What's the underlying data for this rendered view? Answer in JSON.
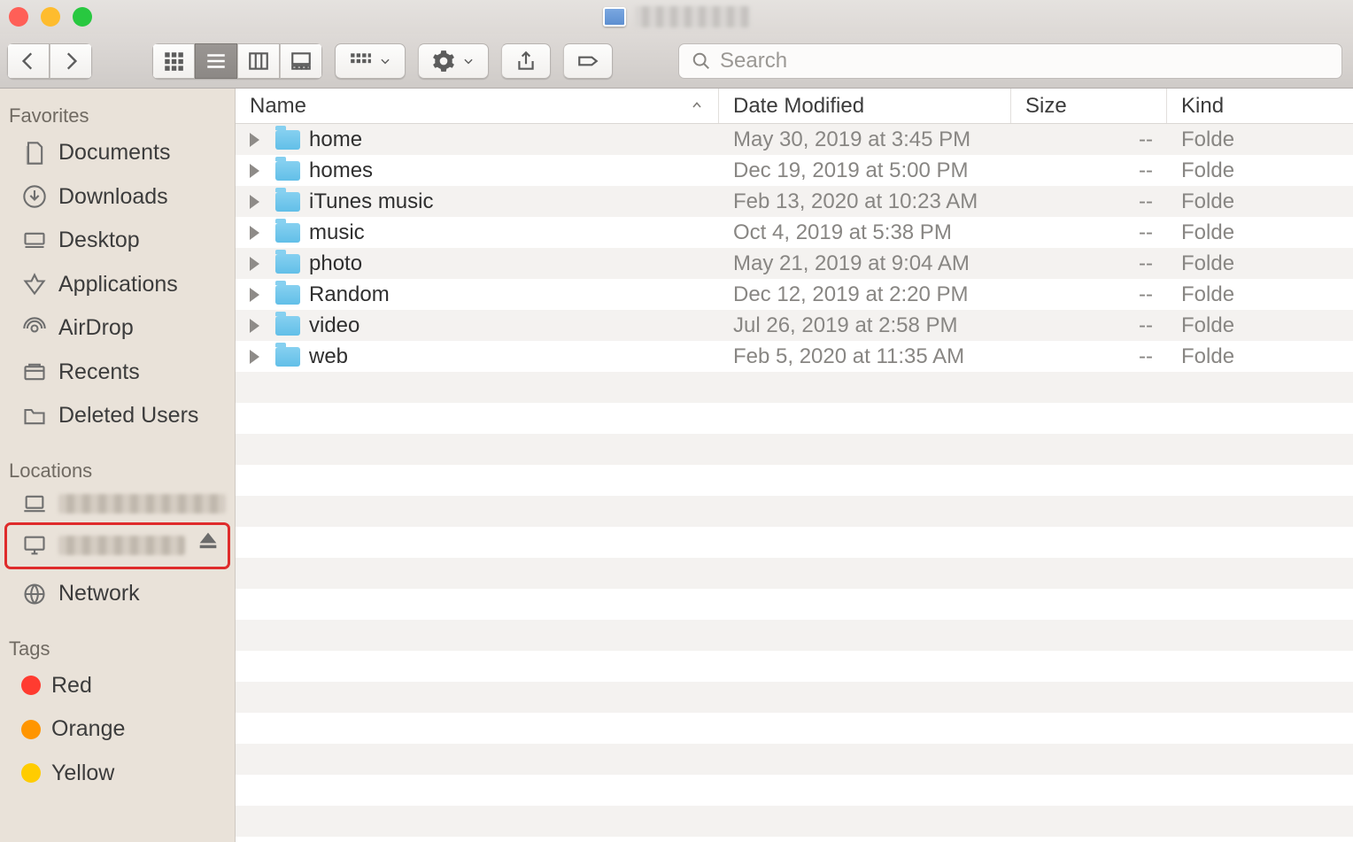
{
  "window": {
    "title": "",
    "title_blurred": true
  },
  "toolbar": {
    "search_placeholder": "Search"
  },
  "sidebar": {
    "sections": [
      {
        "header": "Favorites",
        "items": [
          {
            "icon": "documents",
            "label": "Documents"
          },
          {
            "icon": "downloads",
            "label": "Downloads"
          },
          {
            "icon": "desktop",
            "label": "Desktop"
          },
          {
            "icon": "apps",
            "label": "Applications"
          },
          {
            "icon": "airdrop",
            "label": "AirDrop"
          },
          {
            "icon": "recents",
            "label": "Recents"
          },
          {
            "icon": "folder",
            "label": "Deleted Users"
          }
        ]
      },
      {
        "header": "Locations",
        "items": [
          {
            "icon": "laptop",
            "blurred": true
          },
          {
            "icon": "display",
            "blurred": true,
            "eject": true,
            "highlighted": true
          },
          {
            "icon": "globe",
            "label": "Network"
          }
        ]
      },
      {
        "header": "Tags",
        "items": [
          {
            "tag_color": "#ff3b30",
            "label": "Red"
          },
          {
            "tag_color": "#ff9500",
            "label": "Orange"
          },
          {
            "tag_color": "#ffcc00",
            "label": "Yellow"
          }
        ]
      }
    ]
  },
  "columns": {
    "name": "Name",
    "date": "Date Modified",
    "size": "Size",
    "kind": "Kind"
  },
  "rows": [
    {
      "name": "home",
      "date": "May 30, 2019 at 3:45 PM",
      "size": "--",
      "kind": "Folde"
    },
    {
      "name": "homes",
      "date": "Dec 19, 2019 at 5:00 PM",
      "size": "--",
      "kind": "Folde"
    },
    {
      "name": "iTunes music",
      "date": "Feb 13, 2020 at 10:23 AM",
      "size": "--",
      "kind": "Folde"
    },
    {
      "name": "music",
      "date": "Oct 4, 2019 at 5:38 PM",
      "size": "--",
      "kind": "Folde"
    },
    {
      "name": "photo",
      "date": "May 21, 2019 at 9:04 AM",
      "size": "--",
      "kind": "Folde"
    },
    {
      "name": "Random",
      "date": "Dec 12, 2019 at 2:20 PM",
      "size": "--",
      "kind": "Folde"
    },
    {
      "name": "video",
      "date": "Jul 26, 2019 at 2:58 PM",
      "size": "--",
      "kind": "Folde"
    },
    {
      "name": "web",
      "date": "Feb 5, 2020 at 11:35 AM",
      "size": "--",
      "kind": "Folde"
    }
  ],
  "empty_rows": 15
}
